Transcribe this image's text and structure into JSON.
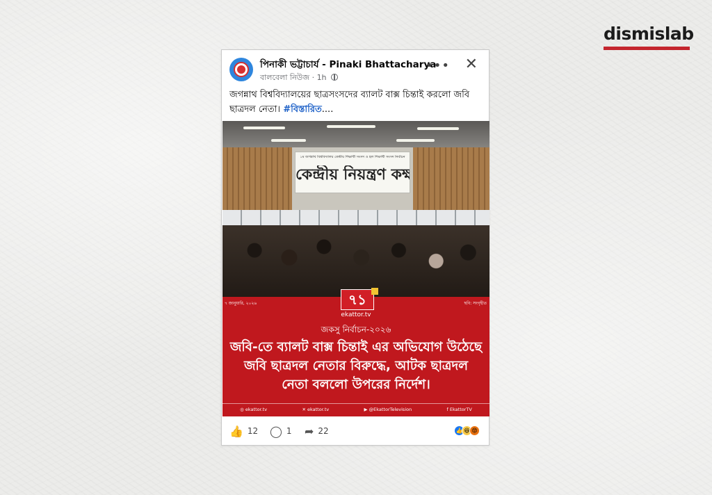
{
  "brand": {
    "name": "dismislab"
  },
  "post": {
    "author": "পিনাকী ভট্টাচার্য - Pinaki Bhattacharya",
    "source": "বালবেলা নিউজ",
    "time": "1h",
    "caption_text": "জগন্নাথ বিশ্ববিদ্যালয়ের ছাত্রসংসদের ব্যালট বাক্স চিন্তাই করলো জবি ছাত্রদল নেতা।",
    "hashtag": "#বিস্তারিত",
    "ellipsis": "...."
  },
  "image": {
    "banner_top": "১ম জগন্নাথ বিশ্ববিদ্যালয় কেন্দ্রীয় শিক্ষার্থী সংসদ ও হল শিক্ষার্থী সংসদ নির্বাচন",
    "banner_main": "কেন্দ্রীয় নিয়ন্ত্রণ কক্ষ",
    "date": "৭ জানুয়ারি, ২০২৬",
    "credit": "ছবি: সংগৃহীত",
    "logo_number": "৭১",
    "logo_name": "ekattor.tv",
    "section_title": "জকসু নির্বাচন-২০২৬",
    "headline": "জবি-তে ব্যালট বাক্স চিন্তাই এর অভিযোগ উঠেছে জবি ছাত্রদল নেতার বিরুদ্ধে, আটক ছাত্রদল নেতা বললো উপরের নির্দেশ।",
    "footer": [
      "ekattor.tv",
      "ekattor.tv",
      "@EkattorTelevision",
      "EkattorTV"
    ]
  },
  "reactions": {
    "likes": "12",
    "comments": "1",
    "shares": "22"
  },
  "colors": {
    "accent_red": "#c0181e",
    "link_blue": "#1b5fc7",
    "brand_bar": "#c4262e"
  },
  "icons": [
    "like-icon",
    "comment-icon",
    "share-icon",
    "more-icon",
    "close-icon",
    "globe-icon"
  ]
}
